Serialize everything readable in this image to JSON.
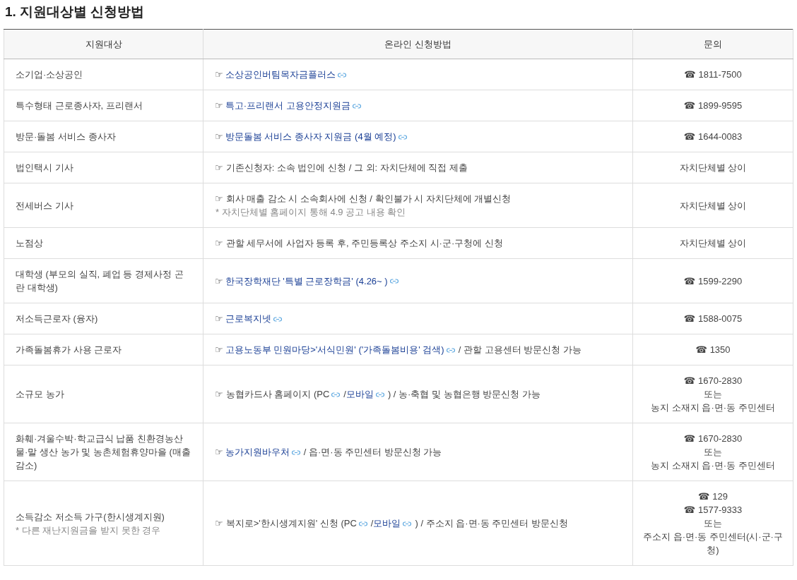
{
  "title": "1. 지원대상별 신청방법",
  "table": {
    "columns": [
      "지원대상",
      "온라인 신청방법",
      "문의"
    ],
    "rows": [
      {
        "target": {
          "text": "소기업·소상공인"
        },
        "method": [
          [
            {
              "kind": "pointer",
              "text": "☞"
            },
            {
              "kind": "link",
              "text": "소상공인버팀목자금플러스"
            },
            {
              "kind": "link_icon"
            }
          ]
        ],
        "contact": [
          {
            "icon": "☎",
            "text": "1811-7500"
          }
        ]
      },
      {
        "target": {
          "text": "특수형태 근로종사자, 프리랜서"
        },
        "method": [
          [
            {
              "kind": "pointer",
              "text": "☞"
            },
            {
              "kind": "link",
              "text": "특고·프리랜서 고용안정지원금"
            },
            {
              "kind": "link_icon"
            }
          ]
        ],
        "contact": [
          {
            "icon": "☎",
            "text": "1899-9595"
          }
        ]
      },
      {
        "target": {
          "text": "방문·돌봄 서비스 종사자"
        },
        "method": [
          [
            {
              "kind": "pointer",
              "text": "☞"
            },
            {
              "kind": "link",
              "text": "방문돌봄 서비스 종사자 지원금 (4월 예정)"
            },
            {
              "kind": "link_icon"
            }
          ]
        ],
        "contact": [
          {
            "icon": "☎",
            "text": "1644-0083"
          }
        ]
      },
      {
        "target": {
          "text": "법인택시 기사"
        },
        "method": [
          [
            {
              "kind": "pointer",
              "text": "☞"
            },
            {
              "kind": "text",
              "text": "기존신청자: 소속 법인에 신청 / 그 외: 자치단체에 직접 제출"
            }
          ]
        ],
        "contact": [
          {
            "text": "자치단체별 상이"
          }
        ]
      },
      {
        "target": {
          "text": "전세버스 기사"
        },
        "method": [
          [
            {
              "kind": "pointer",
              "text": "☞"
            },
            {
              "kind": "text",
              "text": "회사 매출 감소 시 소속회사에 신청 / 확인불가 시 자치단체에 개별신청"
            }
          ],
          [
            {
              "kind": "note",
              "text": "* 자치단체별 홈페이지 통해 4.9 공고 내용 확인"
            }
          ]
        ],
        "contact": [
          {
            "text": "자치단체별 상이"
          }
        ]
      },
      {
        "target": {
          "text": "노점상"
        },
        "method": [
          [
            {
              "kind": "pointer",
              "text": "☞"
            },
            {
              "kind": "text",
              "text": "관할 세무서에 사업자 등록 후, 주민등록상 주소지 시·군·구청에 신청"
            }
          ]
        ],
        "contact": [
          {
            "text": "자치단체별 상이"
          }
        ]
      },
      {
        "target": {
          "text": "대학생 (부모의 실직, 폐업 등 경제사정 곤란 대학생)"
        },
        "method": [
          [
            {
              "kind": "pointer",
              "text": "☞"
            },
            {
              "kind": "link",
              "text": "한국장학재단 '특별 근로장학금' (4.26~ )"
            },
            {
              "kind": "link_icon"
            }
          ]
        ],
        "contact": [
          {
            "icon": "☎",
            "text": "1599-2290"
          }
        ]
      },
      {
        "target": {
          "text": "저소득근로자 (융자)"
        },
        "method": [
          [
            {
              "kind": "pointer",
              "text": "☞"
            },
            {
              "kind": "link",
              "text": "근로복지넷"
            },
            {
              "kind": "link_icon"
            }
          ]
        ],
        "contact": [
          {
            "icon": "☎",
            "text": "1588-0075"
          }
        ]
      },
      {
        "target": {
          "text": "가족돌봄휴가 사용 근로자"
        },
        "method": [
          [
            {
              "kind": "pointer",
              "text": "☞"
            },
            {
              "kind": "link",
              "text": "고용노동부 민원마당>'서식민원' ('가족돌봄비용' 검색)"
            },
            {
              "kind": "link_icon"
            },
            {
              "kind": "text",
              "text": "/ 관할 고용센터 방문신청 가능"
            }
          ]
        ],
        "contact": [
          {
            "icon": "☎",
            "text": "1350"
          }
        ]
      },
      {
        "target": {
          "text": "소규모 농가"
        },
        "method": [
          [
            {
              "kind": "pointer",
              "text": "☞"
            },
            {
              "kind": "text",
              "text": "농협카드사 홈페이지 (PC"
            },
            {
              "kind": "link_icon"
            },
            {
              "kind": "text",
              "text": "/"
            },
            {
              "kind": "link",
              "text": "모바일"
            },
            {
              "kind": "link_icon"
            },
            {
              "kind": "text",
              "text": ") / 농·축협 및 농협은행 방문신청 가능"
            }
          ]
        ],
        "contact": [
          {
            "icon": "☎",
            "text": "1670-2830"
          },
          {
            "text": "또는"
          },
          {
            "text": "농지 소재지 읍·면·동 주민센터"
          }
        ]
      },
      {
        "target": {
          "text": "화훼·겨울수박·학교급식 납품 친환경농산물·말 생산 농가 및 농촌체험휴양마을 (매출감소)"
        },
        "method": [
          [
            {
              "kind": "pointer",
              "text": "☞"
            },
            {
              "kind": "link",
              "text": "농가지원바우처"
            },
            {
              "kind": "link_icon"
            },
            {
              "kind": "text",
              "text": "/ 읍·면·동 주민센터 방문신청 가능"
            }
          ]
        ],
        "contact": [
          {
            "icon": "☎",
            "text": "1670-2830"
          },
          {
            "text": "또는"
          },
          {
            "text": "농지 소재지 읍·면·동 주민센터"
          }
        ]
      },
      {
        "target": {
          "text": "소득감소 저소득 가구(한시생계지원)",
          "note": "* 다른 재난지원금을 받지 못한 경우"
        },
        "method": [
          [
            {
              "kind": "pointer",
              "text": "☞"
            },
            {
              "kind": "text",
              "text": "복지로>'한시생계지원' 신청 (PC"
            },
            {
              "kind": "link_icon"
            },
            {
              "kind": "text",
              "text": "/"
            },
            {
              "kind": "link",
              "text": "모바일"
            },
            {
              "kind": "link_icon"
            },
            {
              "kind": "text",
              "text": ") / 주소지 읍·면·동 주민센터 방문신청"
            }
          ]
        ],
        "contact": [
          {
            "icon": "☎",
            "text": "129"
          },
          {
            "icon": "☎",
            "text": "1577-9333"
          },
          {
            "text": "또는"
          },
          {
            "text": "주소지 읍·면·동 주민센터(시·군·구청)"
          }
        ]
      }
    ]
  }
}
